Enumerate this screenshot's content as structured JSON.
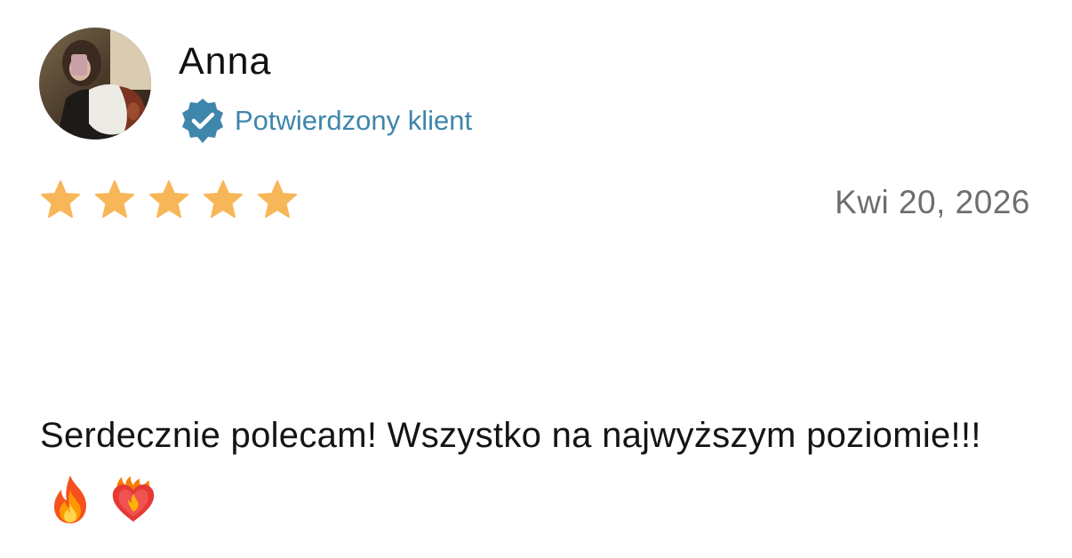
{
  "reviewer": {
    "name": "Anna",
    "verified_label": "Potwierdzony klient",
    "avatar": "avatar-photo"
  },
  "rating": {
    "value": 5,
    "max": 5,
    "star_color": "#f7b758"
  },
  "review": {
    "date": "Kwi 20, 2026",
    "text": "Serdecznie polecam! Wszystko na najwyższym poziomie!!!",
    "emojis": [
      "fire-icon",
      "heart-on-fire-icon"
    ]
  },
  "colors": {
    "verified": "#3e86ab",
    "date_text": "#6e6e6e"
  }
}
